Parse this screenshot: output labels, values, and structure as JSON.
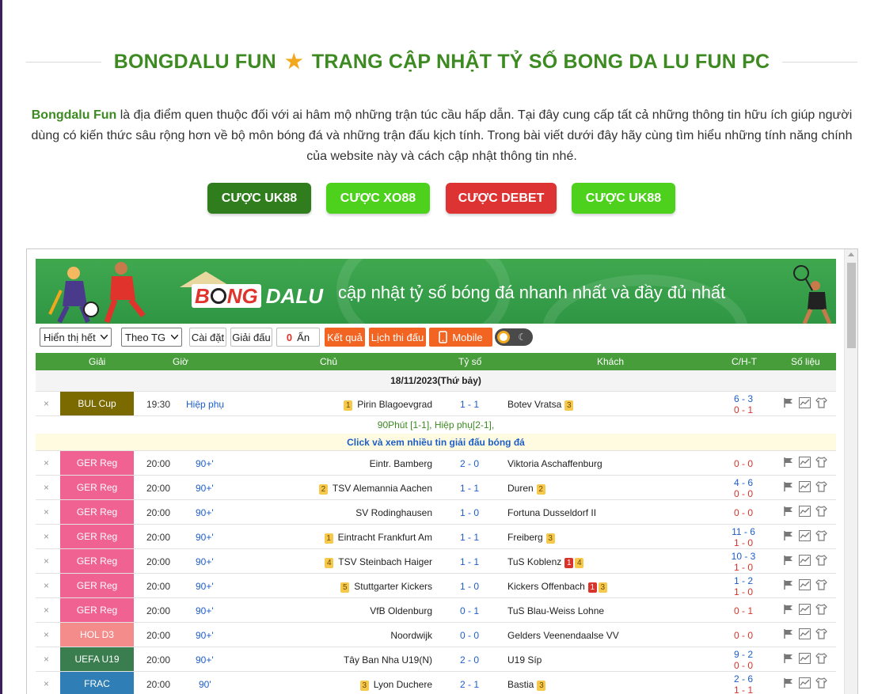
{
  "page": {
    "title_left": "BONGDALU FUN",
    "title_right": "TRANG CẬP NHẬT TỶ SỐ BONG DA LU FUN PC",
    "title_star": "★",
    "intro_brand": "Bongdalu Fun",
    "intro_text": " là địa điểm quen thuộc đối với ai hâm mộ những trận túc cầu hấp dẫn. Tại đây cung cấp tất cả những thông tin hữu ích giúp người dùng có kiến thức sâu rộng hơn về bộ môn bóng đá và những trận đấu kịch tính. Trong bài viết dưới đây hãy cùng tìm hiểu những tính năng chính của website này và cách cập nhật thông tin nhé."
  },
  "cta_buttons": [
    {
      "label": "CƯỢC UK88",
      "color": "#2f7d1d"
    },
    {
      "label": "CƯỢC XO88",
      "color": "#4dd11c"
    },
    {
      "label": "CƯỢC DEBET",
      "color": "#dd3333"
    },
    {
      "label": "CƯỢC UK88",
      "color": "#4dd11c"
    }
  ],
  "banner": {
    "logo_part1": "B",
    "logo_part2": "NG",
    "logo_part3": "DALU",
    "slogan": "cập nhật tỷ số bóng đá nhanh nhất và đầy đủ nhất"
  },
  "toolbar": {
    "show_select": "Hiển thị hết",
    "sort_select": "Theo TG",
    "settings": "Cài đặt",
    "league": "Giải đấu",
    "hidden_count": "0",
    "hidden_label": "Ẩn",
    "results": "Kết quả",
    "schedule": "Lịch thi đấu",
    "mobile": "Mobile"
  },
  "table": {
    "headers": {
      "league": "Giải",
      "time": "Giờ",
      "home": "Chủ",
      "score": "Tỷ số",
      "away": "Khách",
      "ht": "C/H-T",
      "stats": "Số liệu"
    },
    "date": "18/11/2023(Thứ bảy)",
    "close_symbol": "×",
    "extra_info": "90Phút [1-1], Hiệp phụ[2-1],",
    "click_info": "Click và xem nhiều tin giải đấu bóng đá",
    "rows": [
      {
        "league": "BUL Cup",
        "league_color": "#7a6a00",
        "time": "19:30",
        "status": "Hiệp phụ",
        "home_rank": "1",
        "home": "Pirin Blagoevgrad",
        "score": "1 - 1",
        "away": "Botev Vratsa",
        "away_red": "",
        "away_rank": "3",
        "corner": "6 - 3",
        "half": "0 - 1"
      },
      {
        "league": "GER Reg",
        "league_color": "#f06292",
        "time": "20:00",
        "status": "90+'",
        "home_rank": "",
        "home": "Eintr. Bamberg",
        "score": "2 - 0",
        "away": "Viktoria Aschaffenburg",
        "away_red": "",
        "away_rank": "",
        "corner": "",
        "half": "0 - 0"
      },
      {
        "league": "GER Reg",
        "league_color": "#f06292",
        "time": "20:00",
        "status": "90+'",
        "home_rank": "2",
        "home": "TSV Alemannia Aachen",
        "score": "1 - 1",
        "away": "Duren",
        "away_red": "",
        "away_rank": "2",
        "corner": "4 - 6",
        "half": "0 - 0"
      },
      {
        "league": "GER Reg",
        "league_color": "#f06292",
        "time": "20:00",
        "status": "90+'",
        "home_rank": "",
        "home": "SV Rodinghausen",
        "score": "1 - 0",
        "away": "Fortuna Dusseldorf II",
        "away_red": "",
        "away_rank": "",
        "corner": "",
        "half": "0 - 0"
      },
      {
        "league": "GER Reg",
        "league_color": "#f06292",
        "time": "20:00",
        "status": "90+'",
        "home_rank": "1",
        "home": "Eintracht Frankfurt Am",
        "score": "1 - 1",
        "away": "Freiberg",
        "away_red": "",
        "away_rank": "3",
        "corner": "11 - 6",
        "half": "1 - 0"
      },
      {
        "league": "GER Reg",
        "league_color": "#f06292",
        "time": "20:00",
        "status": "90+'",
        "home_rank": "4",
        "home": "TSV Steinbach Haiger",
        "score": "1 - 1",
        "away": "TuS Koblenz",
        "away_red": "1",
        "away_rank": "4",
        "corner": "10 - 3",
        "half": "1 - 0"
      },
      {
        "league": "GER Reg",
        "league_color": "#f06292",
        "time": "20:00",
        "status": "90+'",
        "home_rank": "5",
        "home": "Stuttgarter Kickers",
        "score": "1 - 0",
        "away": "Kickers Offenbach",
        "away_red": "1",
        "away_rank": "3",
        "corner": "1 - 2",
        "half": "1 - 0"
      },
      {
        "league": "GER Reg",
        "league_color": "#f06292",
        "time": "20:00",
        "status": "90+'",
        "home_rank": "",
        "home": "VfB Oldenburg",
        "score": "0 - 1",
        "away": "TuS Blau-Weiss Lohne",
        "away_red": "",
        "away_rank": "",
        "corner": "",
        "half": "0 - 1"
      },
      {
        "league": "HOL D3",
        "league_color": "#f48c8c",
        "time": "20:00",
        "status": "90+'",
        "home_rank": "",
        "home": "Noordwijk",
        "score": "0 - 0",
        "away": "Gelders Veenendaalse VV",
        "away_red": "",
        "away_rank": "",
        "corner": "",
        "half": "0 - 0"
      },
      {
        "league": "UEFA U19",
        "league_color": "#3a7d4e",
        "time": "20:00",
        "status": "90+'",
        "home_rank": "",
        "home": "Tây Ban Nha U19(N)",
        "score": "2 - 0",
        "away": "U19 Síp",
        "away_red": "",
        "away_rank": "",
        "corner": "9 - 2",
        "half": "0 - 0"
      },
      {
        "league": "FRAC",
        "league_color": "#2f7fb6",
        "time": "20:00",
        "status": "90'",
        "home_rank": "3",
        "home": "Lyon Duchere",
        "score": "2 - 1",
        "away": "Bastia",
        "away_red": "",
        "away_rank": "3",
        "corner": "2 - 6",
        "half": "1 - 1"
      }
    ]
  }
}
